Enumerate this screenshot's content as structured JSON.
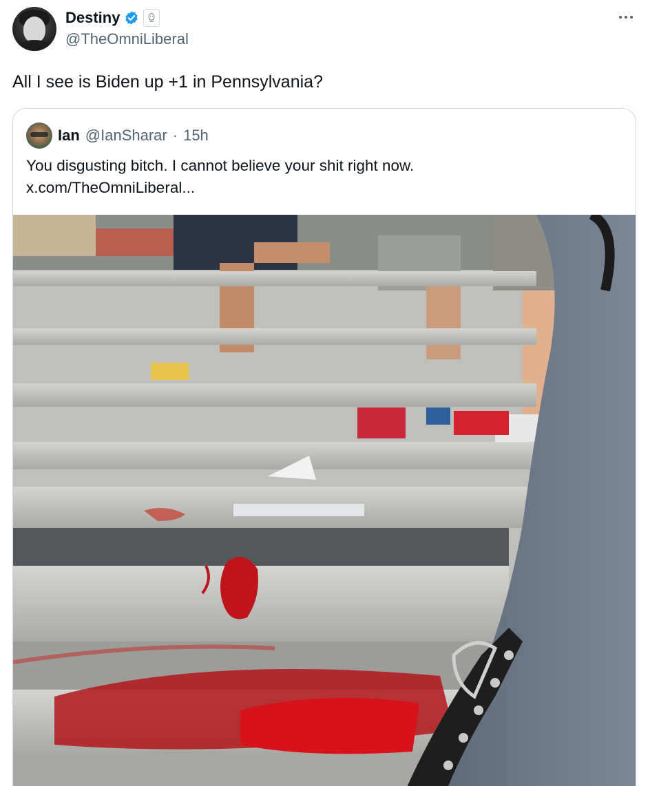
{
  "author": {
    "display_name": "Destiny",
    "handle": "@TheOmniLiberal"
  },
  "tweet": {
    "text": "All I see is Biden up +1 in Pennsylvania?"
  },
  "menu": {
    "more_label": "···"
  },
  "quoted": {
    "display_name": "Ian",
    "handle": "@IanSharar",
    "separator": "·",
    "time": "15h",
    "text_line1": "You disgusting bitch. I cannot believe your shit right now.",
    "text_line2": "x.com/TheOmniLiberal..."
  },
  "icons": {
    "verified": "verified-badge-icon",
    "affiliate": "affiliate-badge-icon",
    "more": "more-dots-icon"
  },
  "colors": {
    "verified": "#1d9bf0",
    "text_primary": "#0f1419",
    "text_secondary": "#536471",
    "border": "#cfd9de",
    "blood": "#b3161c"
  }
}
